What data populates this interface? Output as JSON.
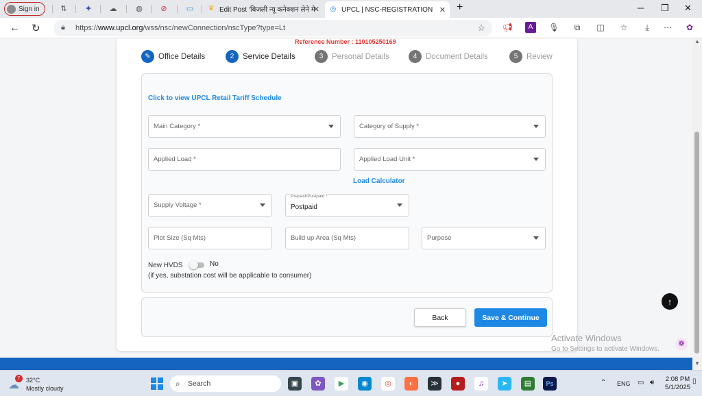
{
  "browser": {
    "signin_label": "Sign in",
    "tabs": [
      {
        "label": "Edit Post ‘बिजली न्यू कनेक्शन लेने मे"
      },
      {
        "label": "UPCL | NSC-REGISTRATION"
      }
    ],
    "url_prefix": "https://",
    "url_domain": "www.upcl.org",
    "url_path": "/wss/nsc/newConnection/nscType?type=Lt"
  },
  "page": {
    "reference_number": "Reference Number : 110105250169",
    "steps": [
      {
        "num": "✎",
        "label": "Office Details"
      },
      {
        "num": "2",
        "label": "Service Details"
      },
      {
        "num": "3",
        "label": "Personal Details"
      },
      {
        "num": "4",
        "label": "Document Details"
      },
      {
        "num": "5",
        "label": "Review"
      }
    ],
    "tariff_link": "Click to view UPCL Retail Tariff Schedule",
    "fields": {
      "main_category": "Main Category *",
      "category_of_supply": "Category of Supply *",
      "applied_load": "Applied Load *",
      "applied_load_unit": "Applied Load Unit *",
      "load_calculator": "Load Calculator",
      "supply_voltage": "Supply Voltage *",
      "prepaid_label": "Prepaid/Postpaid *",
      "prepaid_value": "Postpaid",
      "plot_size": "Plot Size (Sq Mts)",
      "build_up_area": "Build up Area (Sq Mts)",
      "purpose": "Purpose"
    },
    "hvds_label": "New HVDS",
    "hvds_value": "No",
    "hvds_note": "(if yes, substation cost will be applicable to consumer)",
    "back_label": "Back",
    "save_label": "Save & Continue"
  },
  "watermark": {
    "line1": "Activate Windows",
    "line2": "Go to Settings to activate Windows."
  },
  "taskbar": {
    "weather_badge": "7",
    "temperature": "32°C",
    "condition": "Mostly cloudy",
    "search_label": "Search",
    "lang": "ENG",
    "time": "2:08 PM",
    "date": "5/1/2025"
  }
}
